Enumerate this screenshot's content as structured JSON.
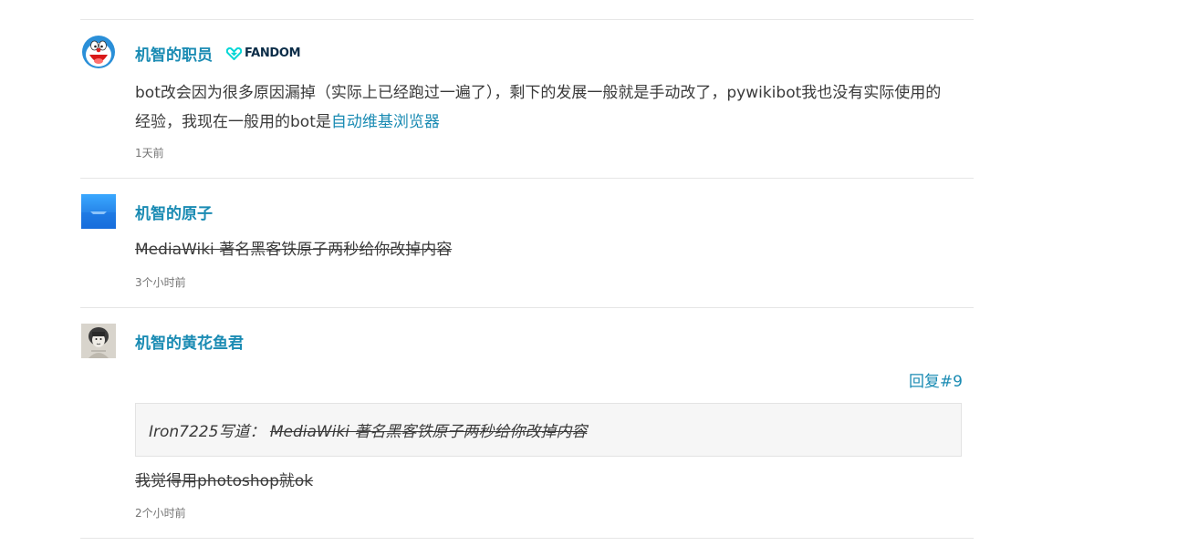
{
  "replies": [
    {
      "author": "机智的职员",
      "badge": "FANDOM",
      "text": "bot改会因为很多原因漏掉（实际上已经跑过一遍了），剩下的发展一般就是手动改了，pywikibot我也没有实际使用的经验，我现在一般用的bot是",
      "link_text": "自动维基浏览器",
      "time": "1天前"
    },
    {
      "author": "机智的原子",
      "text": "MediaWiki 著名黑客铁原子两秒给你改掉内容",
      "time": "3个小时前"
    },
    {
      "author": "机智的黄花鱼君",
      "reply_label": "回复#9",
      "quote_author": "Iron7225写道：",
      "quote_text": "MediaWiki 著名黑客铁原子两秒给你改掉内容",
      "text": "我觉得用photoshop就ok",
      "time": "2个小时前"
    }
  ],
  "colors": {
    "accent": "#1a8bb3",
    "fandom_badge": "#0c2d48",
    "fandom_heart": "#00d6d6",
    "divider": "#e6e6e6",
    "quote_bg": "#f6f6f6"
  }
}
